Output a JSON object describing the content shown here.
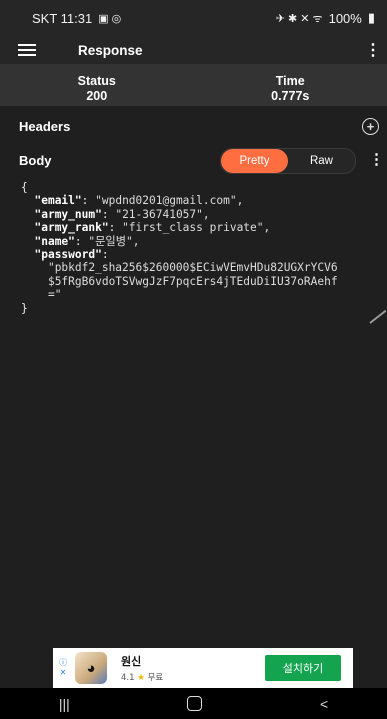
{
  "status_bar": {
    "carrier_time": "SKT 11:31",
    "left_icons": "▣ ◎",
    "right_icons": "✈ ✱ ✕ ᯤ",
    "battery": "100%"
  },
  "app_bar": {
    "title": "Response",
    "menu_icon": "hamburger-menu-icon",
    "overflow_icon": "more-vert-icon"
  },
  "summary": {
    "status_label": "Status",
    "status_value": "200",
    "time_label": "Time",
    "time_value": "0.777s"
  },
  "headers": {
    "label": "Headers",
    "add_icon": "add-circle-icon"
  },
  "body": {
    "label": "Body",
    "view_toggle": {
      "pretty_label": "Pretty",
      "raw_label": "Raw",
      "selected": "Pretty"
    },
    "json_lines": {
      "open": "{",
      "email_key": "\"email\"",
      "email_val": "\"wpdnd0201@gmail.com\",",
      "army_num_key": "\"army_num\"",
      "army_num_val": "\"21-36741057\",",
      "army_rank_key": "\"army_rank\"",
      "army_rank_val": "\"first_class private\",",
      "name_key": "\"name\"",
      "name_val": "\"문일병\",",
      "password_key": "\"password\"",
      "password_line1": "\"pbkdf2_sha256$260000$ECiwVEmvHDu82UGXrYCV6",
      "password_line2": "$5fRgB6vdoTSVwgJzF7pqcErs4jTEduDiIU37oRAehf",
      "password_line3": "=\"",
      "close": "}"
    }
  },
  "ad": {
    "app_name": "원신",
    "rating": "4.1",
    "price": "무료",
    "install_label": "설치하기"
  },
  "nav_bar": {
    "recents": "|||",
    "back": "<"
  },
  "colors": {
    "accent": "#ff6e40",
    "install": "#14a450",
    "background": "#1f1f1f"
  }
}
